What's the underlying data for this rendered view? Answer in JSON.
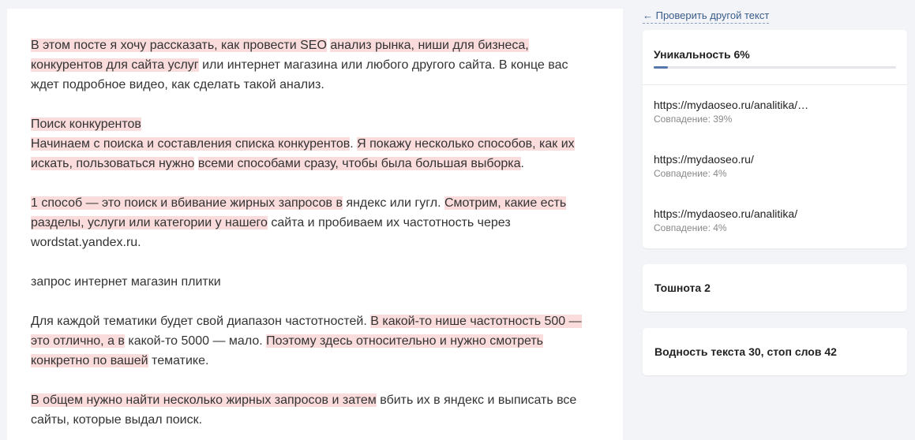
{
  "back_link": "← Проверить другой текст",
  "text_paragraphs": [
    [
      {
        "t": "В этом посте я хочу рассказать, как провести SEO",
        "h": true
      },
      {
        "t": " ",
        "h": false
      },
      {
        "t": "анализ рынка, ниши для бизнеса, конкурентов для сайта услуг",
        "h": true
      },
      {
        "t": " или интернет магазина или любого другого сайта. В конце вас ждет подробное видео, как сделать такой анализ.",
        "h": false
      }
    ],
    [
      {
        "t": "Поиск конкурентов",
        "h": true
      },
      {
        "t": "\n",
        "h": false
      },
      {
        "t": "Начинаем с поиска и составления списка конкурентов",
        "h": true
      },
      {
        "t": ". ",
        "h": false
      },
      {
        "t": "Я покажу несколько способов, как их искать, пользоваться нужно",
        "h": true
      },
      {
        "t": " ",
        "h": false
      },
      {
        "t": "всеми способами сразу, чтобы была большая выборка",
        "h": true
      },
      {
        "t": ".",
        "h": false
      }
    ],
    [
      {
        "t": "1 способ — это поиск и вбивание жирных запросов в",
        "h": true
      },
      {
        "t": " яндекс или гугл. ",
        "h": false
      },
      {
        "t": "Смотрим, какие есть разделы, услуги или категории у нашего",
        "h": true
      },
      {
        "t": " сайта и пробиваем их частотность через wordstat.yandex.ru.",
        "h": false
      }
    ],
    [
      {
        "t": "запрос интернет магазин плитки",
        "h": false
      }
    ],
    [
      {
        "t": "Для каждой тематики будет свой диапазон частотностей. ",
        "h": false
      },
      {
        "t": "В какой-то нише частотность 500 — это отлично, а в",
        "h": true
      },
      {
        "t": " какой-то 5000 — мало. ",
        "h": false
      },
      {
        "t": "Поэтому здесь относительно и нужно смотреть конкретно по вашей",
        "h": true
      },
      {
        "t": " тематике.",
        "h": false
      }
    ],
    [
      {
        "t": "В общем нужно найти несколько жирных запросов и затем",
        "h": true
      },
      {
        "t": " вбить их в яндекс и выписать все сайты, которые выдал поиск.",
        "h": false
      }
    ]
  ],
  "uniqueness": {
    "title": "Уникальность 6%",
    "percent": 6,
    "accent_color": "#5577aa",
    "matches": [
      {
        "url": "https://mydaoseo.ru/analitika/ekspress-analiz",
        "label": "Совпадение: 39%"
      },
      {
        "url": "https://mydaoseo.ru/",
        "label": "Совпадение: 4%"
      },
      {
        "url": "https://mydaoseo.ru/analitika/",
        "label": "Совпадение: 4%"
      }
    ]
  },
  "nausea": {
    "title": "Тошнота 2"
  },
  "water": {
    "title": "Водность текста 30, стоп слов 42"
  }
}
